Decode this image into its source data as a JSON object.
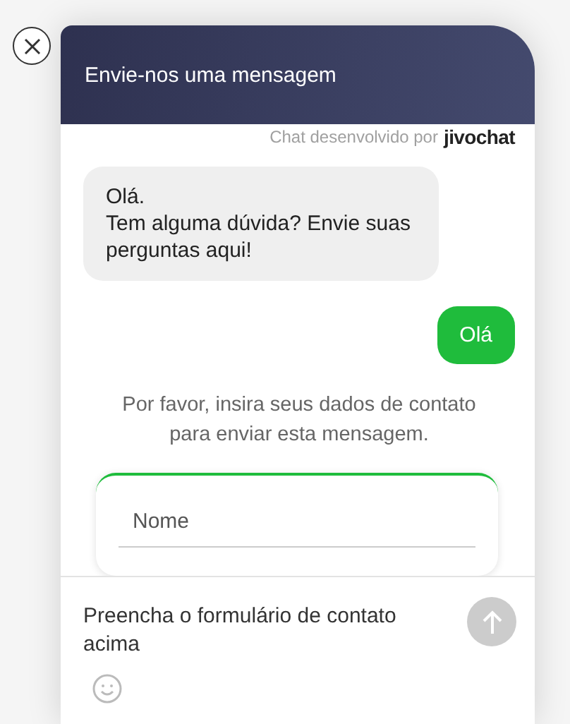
{
  "header": {
    "title": "Envie-nos uma mensagem"
  },
  "powered_by": {
    "text": "Chat desenvolvido por",
    "brand": "jivochat"
  },
  "messages": [
    {
      "kind": "agent",
      "lines": [
        "Olá.",
        "Tem alguma dúvida? Envie suas perguntas aqui!"
      ]
    },
    {
      "kind": "visitor",
      "lines": [
        "Olá"
      ]
    }
  ],
  "notice": "Por favor, insira seus dados de contato para enviar esta mensagem.",
  "contact_form": {
    "fields": [
      {
        "placeholder": "Nome"
      }
    ]
  },
  "composer": {
    "placeholder": "Preencha o formulário de contato acima",
    "send_disabled": true
  }
}
